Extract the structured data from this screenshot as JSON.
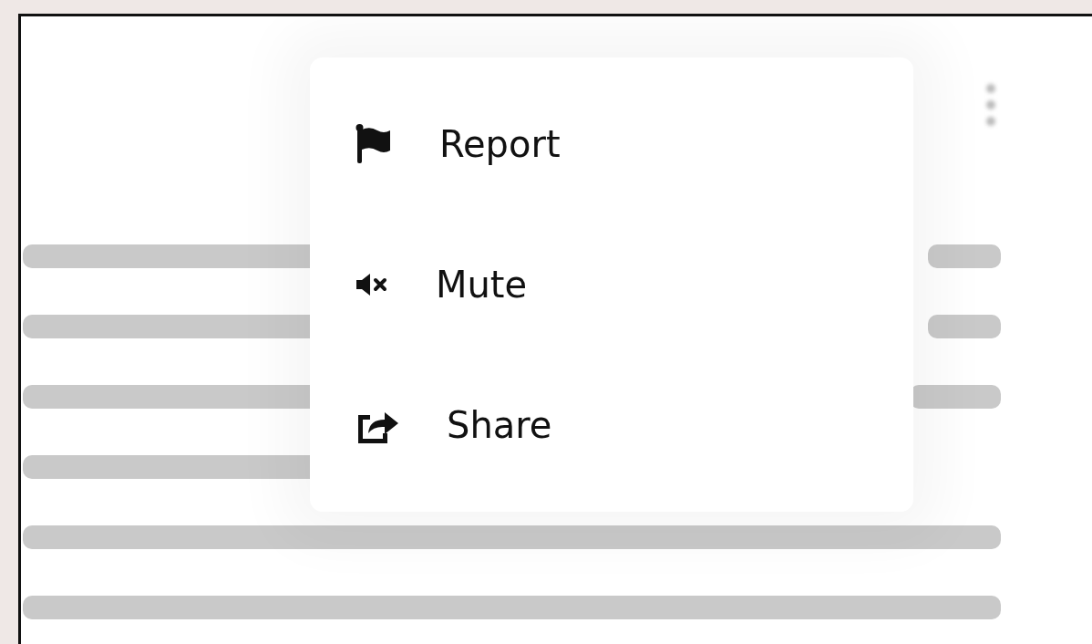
{
  "menu": [
    {
      "kind": "flag",
      "label": "Report"
    },
    {
      "kind": "mute",
      "label": "Mute"
    },
    {
      "kind": "share",
      "label": "Share"
    }
  ]
}
